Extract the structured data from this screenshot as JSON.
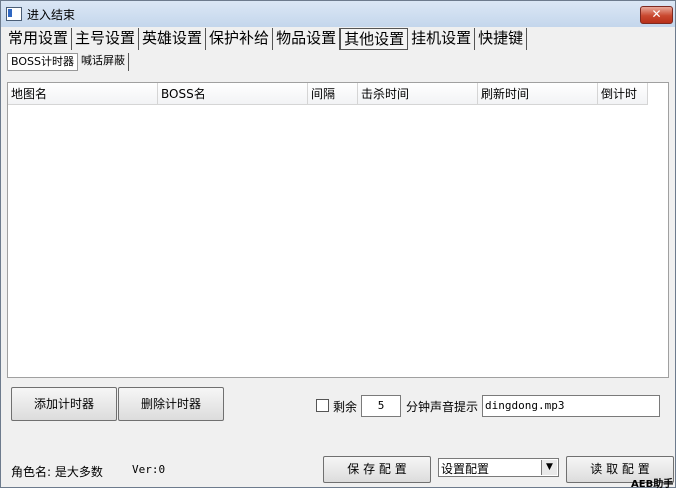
{
  "window": {
    "title": "进入结束",
    "close_label": "✕"
  },
  "tabs": [
    "常用设置",
    "主号设置",
    "英雄设置",
    "保护补给",
    "物品设置",
    "其他设置",
    "挂机设置",
    "快捷键"
  ],
  "subtabs": [
    "BOSS计时器",
    "喊话屏蔽"
  ],
  "table": {
    "columns": [
      "地图名",
      "BOSS名",
      "间隔",
      "击杀时间",
      "刷新时间",
      "倒计时"
    ],
    "rows": []
  },
  "controls": {
    "add_timer": "添加计时器",
    "delete_timer": "删除计时器",
    "remain_label": "剩余",
    "minutes_value": "5",
    "minutes_suffix": "分钟声音提示",
    "sound_file": "dingdong.mp3"
  },
  "footer": {
    "role_label": "角色名: 是大多数",
    "version": "Ver:0",
    "save_config": "保 存 配 置",
    "config_select": "设置配置",
    "load_config": "读 取 配 置",
    "watermark": "AEB助手"
  }
}
